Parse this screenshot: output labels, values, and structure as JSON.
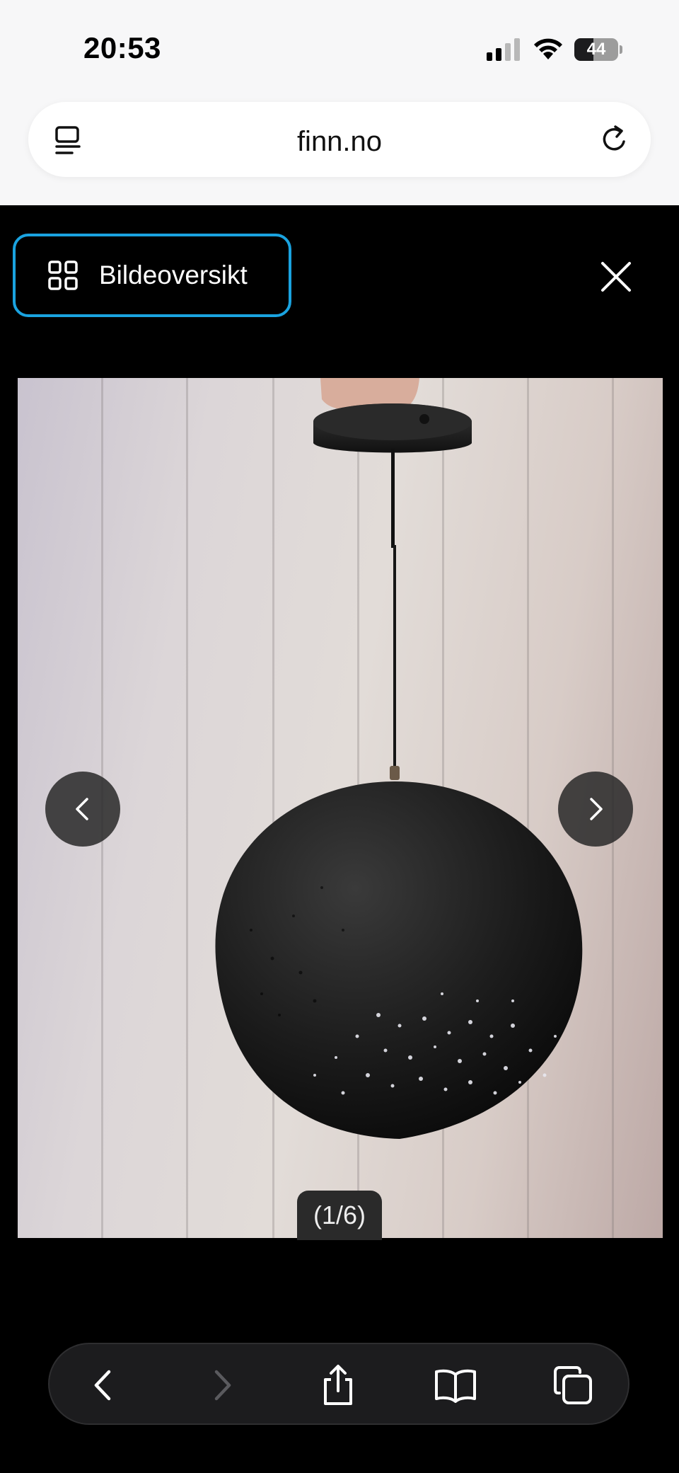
{
  "status_bar": {
    "time": "20:53",
    "battery_level": "44",
    "signal_bars_active": 2,
    "signal_bars_total": 4
  },
  "address_bar": {
    "url": "finn.no",
    "left_icon": "reader-icon",
    "right_icon": "reload-icon"
  },
  "viewer": {
    "overview_button_label": "Bildeoversikt",
    "overview_icon": "grid-icon",
    "close_icon": "close-icon",
    "prev_icon": "chevron-left-icon",
    "next_icon": "chevron-right-icon",
    "image_counter": "(1/6)",
    "focus_color": "#1aa3e0"
  },
  "safari_toolbar": {
    "buttons": [
      "back-icon",
      "forward-icon",
      "share-icon",
      "bookmarks-icon",
      "tabs-icon"
    ]
  }
}
